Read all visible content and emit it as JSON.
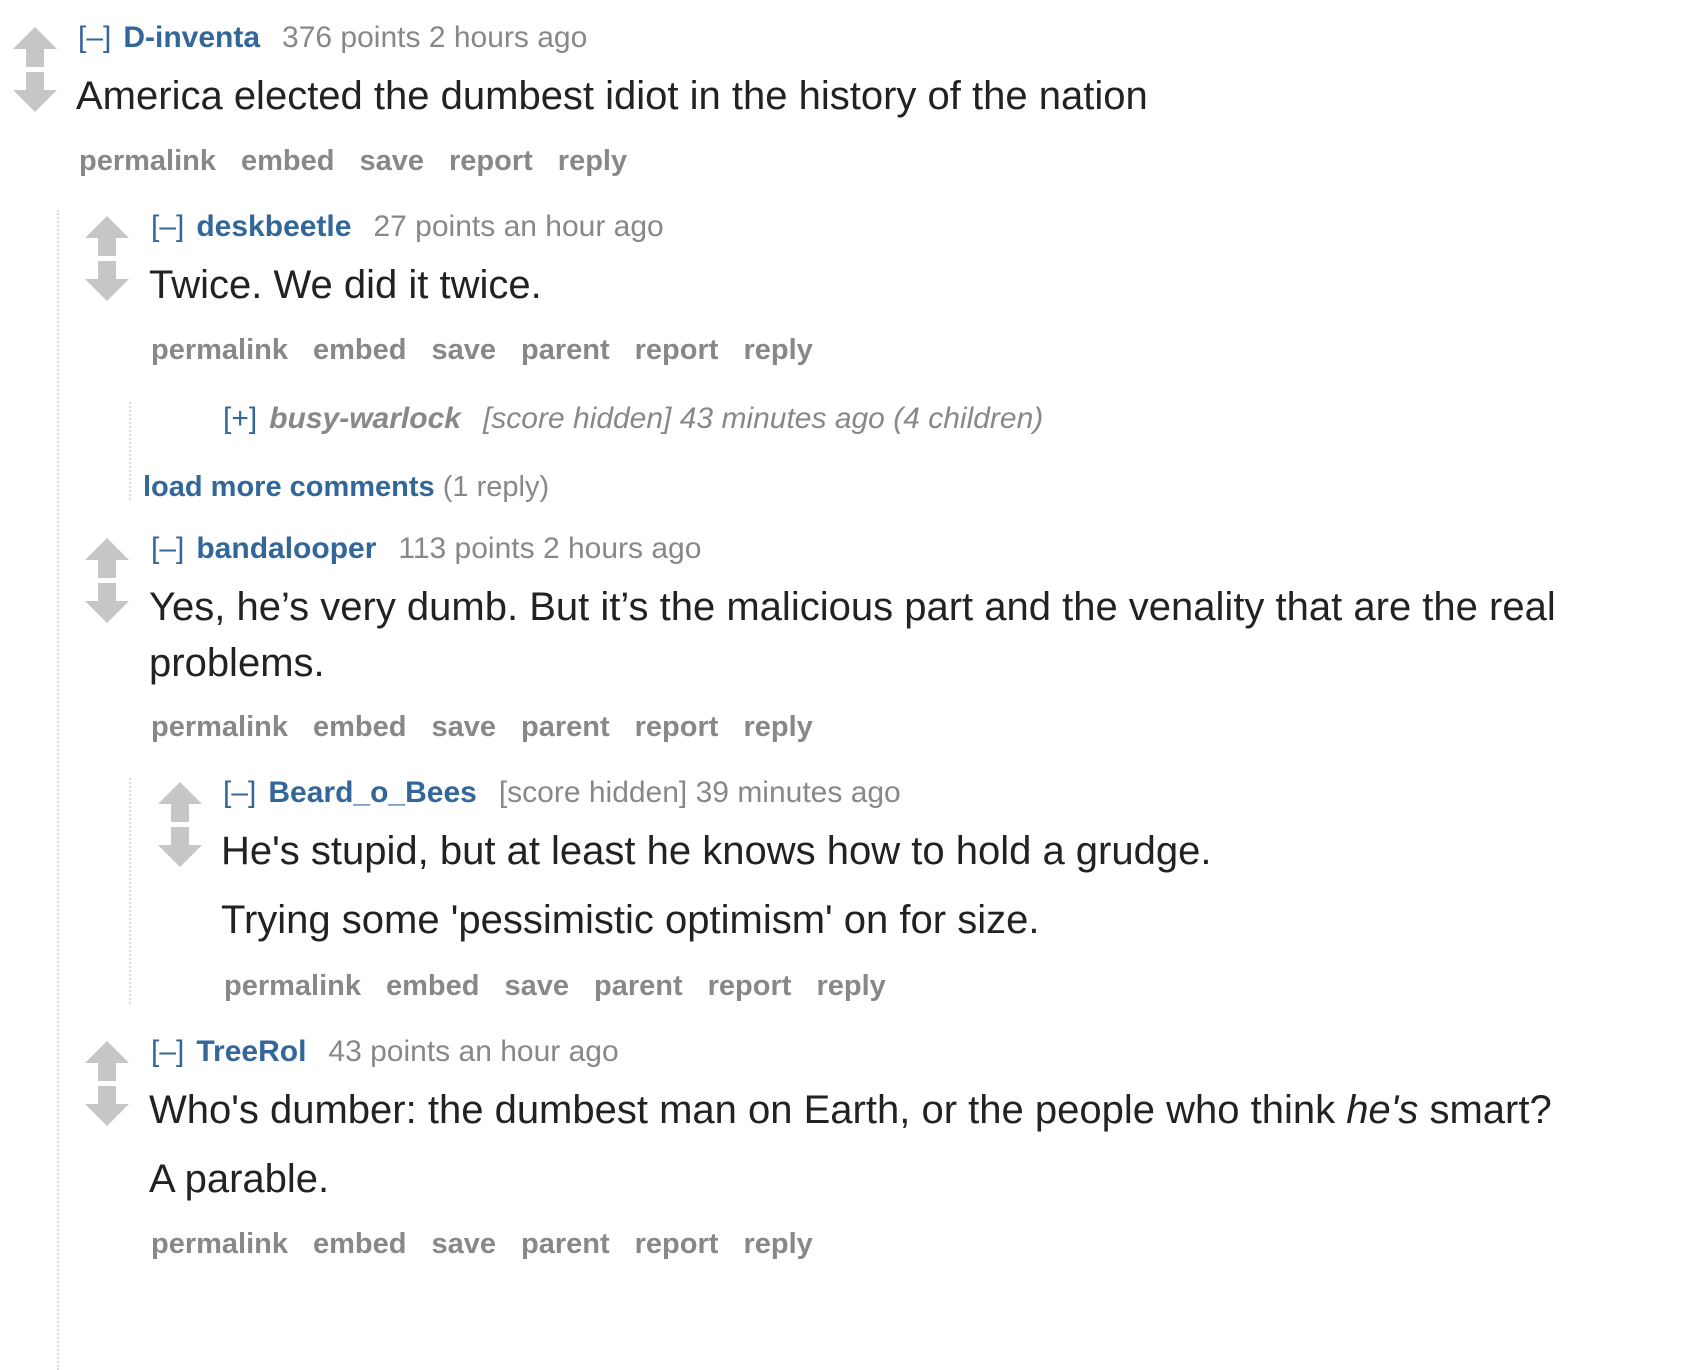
{
  "actions": {
    "permalink": "permalink",
    "embed": "embed",
    "save": "save",
    "parent": "parent",
    "report": "report",
    "reply": "reply"
  },
  "c1": {
    "expand": "[–]",
    "author": "D-inventa",
    "score": "376 points",
    "time": "2 hours ago",
    "body": "America elected the dumbest idiot in the history of the nation"
  },
  "c2": {
    "expand": "[–]",
    "author": "deskbeetle",
    "score": "27 points",
    "time": "an hour ago",
    "body": "Twice. We did it twice."
  },
  "c3": {
    "expand": "[+]",
    "author": "busy-warlock",
    "score": "[score hidden]",
    "time": "43 minutes ago",
    "children": "(4 children)"
  },
  "loadmore": {
    "label": "load more comments",
    "count": "(1 reply)"
  },
  "c4": {
    "expand": "[–]",
    "author": "bandalooper",
    "score": "113 points",
    "time": "2 hours ago",
    "body_line1": "Yes, he’s very dumb. But it’s the malicious part and the venality that are the real",
    "body_line2": "problems."
  },
  "c5": {
    "expand": "[–]",
    "author": "Beard_o_Bees",
    "score": "[score hidden]",
    "time": "39 minutes ago",
    "body_p1": "He's stupid, but at least he knows how to hold a grudge.",
    "body_p2": "Trying some 'pessimistic optimism' on for size."
  },
  "c6": {
    "expand": "[–]",
    "author": "TreeRol",
    "score": "43 points",
    "time": "an hour ago",
    "body_p1_a": "Who's dumber: the dumbest man on Earth, or the people who think ",
    "body_p1_em": "he's",
    "body_p1_b": " smart?",
    "body_p2": "A parable."
  },
  "icons": {
    "upvote": "upvote-arrow-icon",
    "downvote": "downvote-arrow-icon"
  },
  "colors": {
    "link": "#336699",
    "muted": "#888888",
    "text": "#222222",
    "arrow": "#c6c6c6"
  }
}
